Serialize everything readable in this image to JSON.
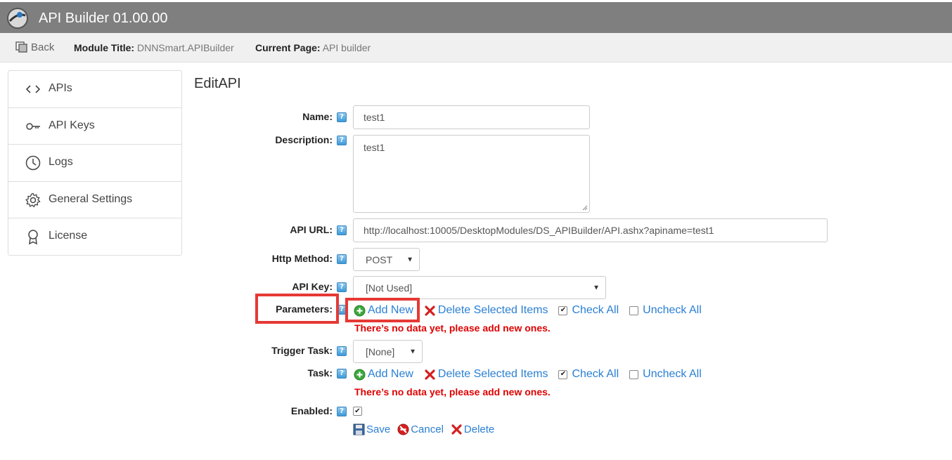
{
  "app": {
    "title": "API Builder 01.00.00"
  },
  "subbar": {
    "back_label": "Back",
    "module_title_label": "Module Title:",
    "module_title_value": "DNNSmart.APIBuilder",
    "current_page_label": "Current Page:",
    "current_page_value": "API builder"
  },
  "sidebar": {
    "items": [
      {
        "label": "APIs",
        "icon": "code-icon"
      },
      {
        "label": "API Keys",
        "icon": "key-icon"
      },
      {
        "label": "Logs",
        "icon": "clock-icon"
      },
      {
        "label": "General Settings",
        "icon": "gear-icon"
      },
      {
        "label": "License",
        "icon": "award-icon"
      }
    ]
  },
  "form": {
    "heading": "EditAPI",
    "help_glyph": "?",
    "name_label": "Name:",
    "name_value": "test1",
    "description_label": "Description:",
    "description_value": "test1",
    "api_url_label": "API URL:",
    "api_url_value": "http://localhost:10005/DesktopModules/DS_APIBuilder/API.ashx?apiname=test1",
    "http_method_label": "Http Method:",
    "http_method_value": "POST",
    "api_key_label": "API Key:",
    "api_key_value": "[Not Used]",
    "parameters_label": "Parameters:",
    "trigger_task_label": "Trigger Task:",
    "trigger_task_value": "[None]",
    "task_label": "Task:",
    "enabled_label": "Enabled:",
    "enabled_checked": true
  },
  "list_actions": {
    "add_new": "Add New",
    "delete_selected": "Delete Selected Items",
    "check_all": "Check All",
    "uncheck_all": "Uncheck All",
    "no_data": "There’s no data yet, please add new ones."
  },
  "footer": {
    "save": "Save",
    "cancel": "Cancel",
    "delete": "Delete"
  },
  "colors": {
    "titlebar": "#7f7f7f",
    "link": "#2a7fd4",
    "error": "#e00000",
    "highlight_box": "#e53935"
  }
}
